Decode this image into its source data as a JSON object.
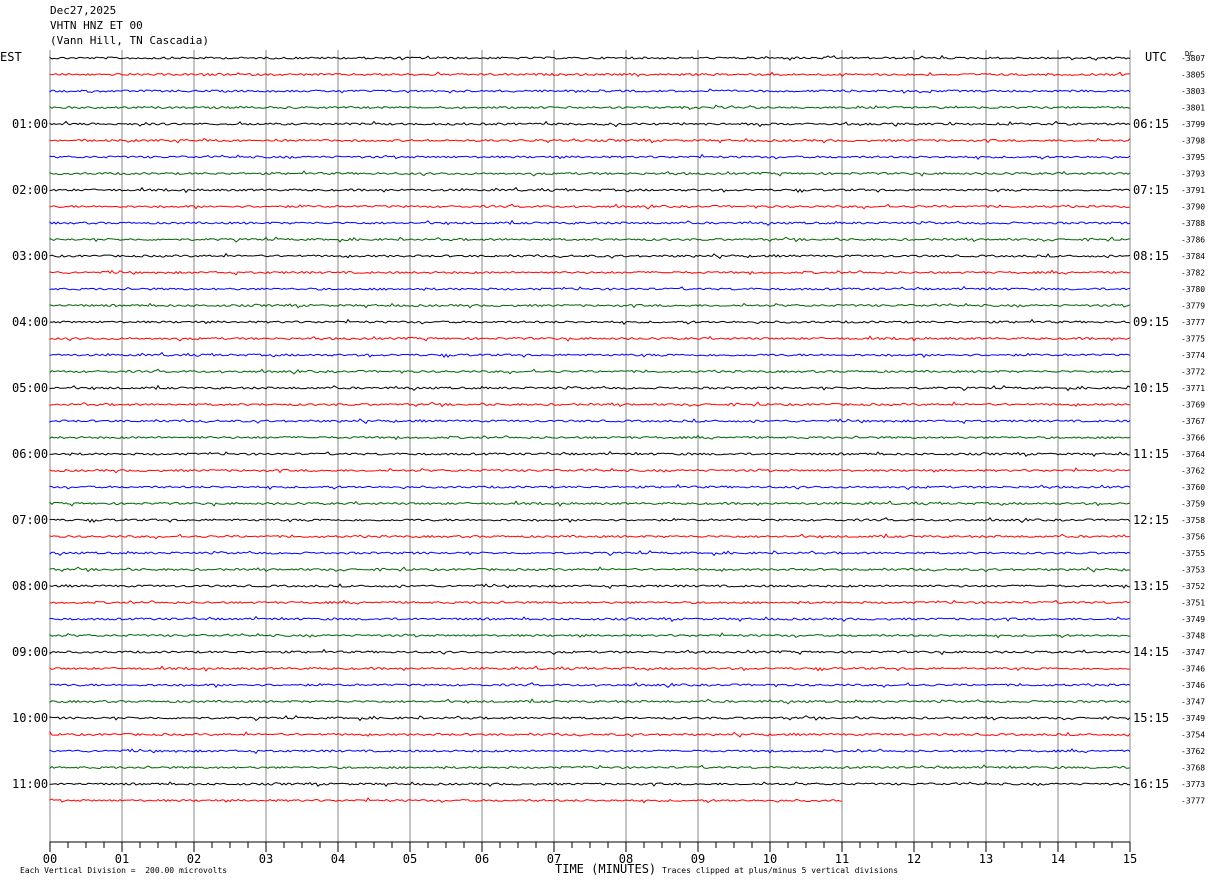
{
  "header": {
    "date": "Dec27,2025",
    "station": "VHTN HNZ ET 00",
    "location": "(Vann Hill, TN Cascadia)"
  },
  "labels": {
    "left_tz": "EST",
    "right_tz": "UTC",
    "dc": "DC"
  },
  "footer": {
    "scale_note": "Each Vertical Division =  200.00 microvolts",
    "xlabel": "TIME (MINUTES)",
    "clip_note": "Traces clipped at plus/minus 5 vertical divisions"
  },
  "colors": {
    "black": "#000000",
    "red": "#ff0000",
    "blue": "#0000ff",
    "green": "#006400",
    "grid": "#888888"
  },
  "chart_data": {
    "type": "line",
    "title": "",
    "xlabel": "TIME (MINUTES)",
    "xlim": [
      0,
      15
    ],
    "x_ticks": [
      "00",
      "01",
      "02",
      "03",
      "04",
      "05",
      "06",
      "07",
      "08",
      "09",
      "10",
      "11",
      "12",
      "13",
      "14",
      "15"
    ],
    "row_color_cycle": [
      "black",
      "red",
      "blue",
      "green"
    ],
    "rows_total": 46,
    "last_row_end_minute": 11,
    "est_hour_labels": [
      {
        "row": 4,
        "label": "01:00"
      },
      {
        "row": 8,
        "label": "02:00"
      },
      {
        "row": 12,
        "label": "03:00"
      },
      {
        "row": 16,
        "label": "04:00"
      },
      {
        "row": 20,
        "label": "05:00"
      },
      {
        "row": 24,
        "label": "06:00"
      },
      {
        "row": 28,
        "label": "07:00"
      },
      {
        "row": 32,
        "label": "08:00"
      },
      {
        "row": 36,
        "label": "09:00"
      },
      {
        "row": 40,
        "label": "10:00"
      },
      {
        "row": 44,
        "label": "11:00"
      }
    ],
    "utc_labels": [
      {
        "row": 4,
        "label": "06:15"
      },
      {
        "row": 8,
        "label": "07:15"
      },
      {
        "row": 12,
        "label": "08:15"
      },
      {
        "row": 16,
        "label": "09:15"
      },
      {
        "row": 20,
        "label": "10:15"
      },
      {
        "row": 24,
        "label": "11:15"
      },
      {
        "row": 28,
        "label": "12:15"
      },
      {
        "row": 32,
        "label": "13:15"
      },
      {
        "row": 36,
        "label": "14:15"
      },
      {
        "row": 40,
        "label": "15:15"
      },
      {
        "row": 44,
        "label": "16:15"
      }
    ],
    "dc_offsets": [
      "-3807",
      "-3805",
      "-3803",
      "-3801",
      "-3799",
      "-3798",
      "-3795",
      "-3793",
      "-3791",
      "-3790",
      "-3788",
      "-3786",
      "-3784",
      "-3782",
      "-3780",
      "-3779",
      "-3777",
      "-3775",
      "-3774",
      "-3772",
      "-3771",
      "-3769",
      "-3767",
      "-3766",
      "-3764",
      "-3762",
      "-3760",
      "-3759",
      "-3758",
      "-3756",
      "-3755",
      "-3753",
      "-3752",
      "-3751",
      "-3749",
      "-3748",
      "-3747",
      "-3746",
      "-3746",
      "-3747",
      "-3749",
      "-3754",
      "-3762",
      "-3768",
      "-3773",
      "-3777"
    ]
  }
}
